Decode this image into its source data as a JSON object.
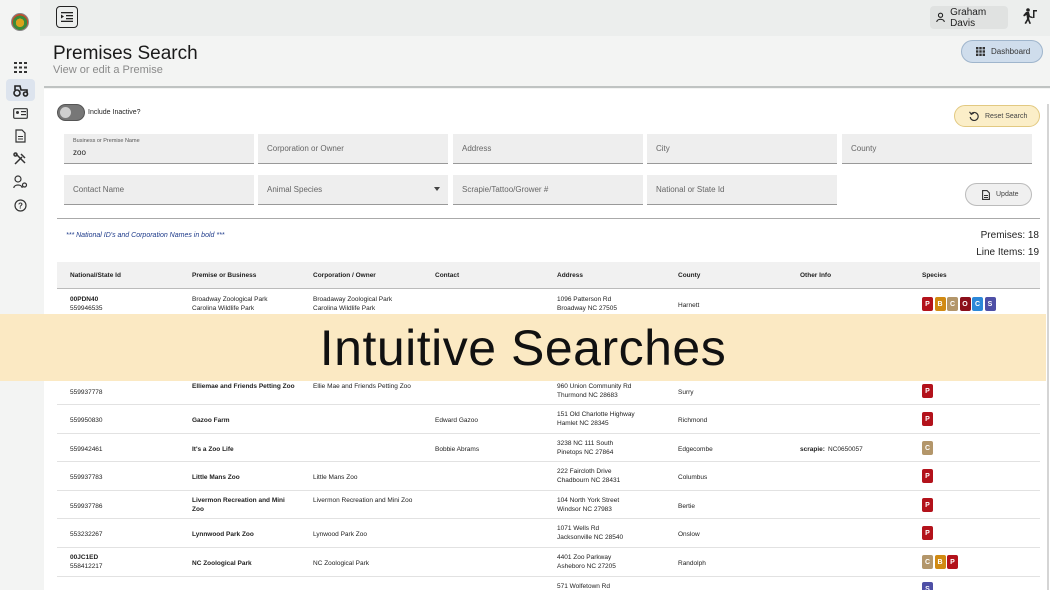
{
  "user": {
    "name": "Graham Davis"
  },
  "header": {
    "title": "Premises Search",
    "subtitle": "View or edit a Premise",
    "dashboard_label": "Dashboard"
  },
  "filters": {
    "include_inactive_label": "Include Inactive?",
    "reset_label": "Reset Search",
    "update_label": "Update",
    "business_label": "Business or Premise Name",
    "business_value": "zoo",
    "corporation_placeholder": "Corporation or Owner",
    "address_placeholder": "Address",
    "city_placeholder": "City",
    "county_placeholder": "County",
    "contact_placeholder": "Contact Name",
    "species_placeholder": "Animal Species",
    "scrapie_placeholder": "Scrapie/Tattoo/Grower #",
    "national_placeholder": "National or State Id"
  },
  "results": {
    "note": "*** National ID's and Corporation Names in bold ***",
    "premises": "Premises: 18",
    "line_items": "Line Items: 19"
  },
  "table": {
    "columns": [
      "National/State Id",
      "Premise or Business",
      "Corporation / Owner",
      "Contact",
      "Address",
      "County",
      "Other Info",
      "Species"
    ],
    "rows": [
      {
        "nid": "00PDN40",
        "sid": "559946535",
        "premise": "Broadway Zoological Park",
        "premise2": "Carolina Wildlife Park",
        "corp": "Broadaway Zoological Park",
        "corp2": "Carolina Wildlife Park",
        "contact": "",
        "addr1": "1096 Patterson Rd",
        "addr2": "Broadway NC 27505",
        "county": "Harnett",
        "other_label": "",
        "other": "",
        "species": [
          "P",
          "B",
          "C",
          "O",
          "C",
          "S"
        ]
      },
      {
        "nid": "",
        "sid": "559937778",
        "premise": "Elliemae and Friends Petting Zoo",
        "premise2": "",
        "corp": "Ellie Mae and Friends Petting Zoo",
        "corp2": "",
        "contact": "",
        "addr1": "960 Union Community Rd",
        "addr2": "Thurmond NC 28683",
        "county": "Surry",
        "other_label": "",
        "other": "",
        "species": [
          "P"
        ]
      },
      {
        "nid": "",
        "sid": "559950830",
        "premise": "Gazoo Farm",
        "premise2": "",
        "corp": "",
        "corp2": "",
        "contact": "Edward Gazoo",
        "addr1": "151 Old Charlotte Highway",
        "addr2": "Hamlet NC 28345",
        "county": "Richmond",
        "other_label": "",
        "other": "",
        "species": [
          "P"
        ]
      },
      {
        "nid": "",
        "sid": "559942461",
        "premise": "It's a Zoo Life",
        "premise2": "",
        "corp": "",
        "corp2": "",
        "contact": "Bobbie Abrams",
        "addr1": "3238 NC 111 South",
        "addr2": "Pinetops NC 27864",
        "county": "Edgecombe",
        "other_label": "scrapie:",
        "other": "NC0650057",
        "species": [
          "C"
        ]
      },
      {
        "nid": "",
        "sid": "559937783",
        "premise": "Little Mans Zoo",
        "premise2": "",
        "corp": "Little Mans Zoo",
        "corp2": "",
        "contact": "",
        "addr1": "222 Faircloth Drive",
        "addr2": "Chadbourn NC 28431",
        "county": "Columbus",
        "other_label": "",
        "other": "",
        "species": [
          "P"
        ]
      },
      {
        "nid": "",
        "sid": "559937786",
        "premise": "Livermon Recreation and Mini Zoo",
        "premise2": "",
        "corp": "Livermon Recreation and Mini Zoo",
        "corp2": "",
        "contact": "",
        "addr1": "104 North York Street",
        "addr2": "Windsor NC 27983",
        "county": "Bertie",
        "other_label": "",
        "other": "",
        "species": [
          "P"
        ]
      },
      {
        "nid": "",
        "sid": "553232267",
        "premise": "Lynnwood Park Zoo",
        "premise2": "",
        "corp": "Lynwood Park Zoo",
        "corp2": "",
        "contact": "",
        "addr1": "1071 Wells Rd",
        "addr2": "Jacksonville NC 28540",
        "county": "Onslow",
        "other_label": "",
        "other": "",
        "species": [
          "P"
        ]
      },
      {
        "nid": "00JC1ED",
        "sid": "558412217",
        "premise": "NC Zoological Park",
        "premise2": "",
        "corp": "NC Zoological Park",
        "corp2": "",
        "contact": "",
        "addr1": "4401 Zoo Parkway",
        "addr2": "Asheboro NC 27205",
        "county": "Randolph",
        "other_label": "",
        "other": "",
        "species": [
          "C",
          "B",
          "P"
        ]
      },
      {
        "nid": "",
        "sid": "",
        "premise": "",
        "premise2": "",
        "corp": "",
        "corp2": "",
        "contact": "",
        "addr1": "571 Wolfetown Rd",
        "addr2": "",
        "county": "",
        "other_label": "",
        "other": "",
        "species": [
          "S"
        ]
      }
    ]
  },
  "species_colors": {
    "P": "#b3121b",
    "B": "#d18a12",
    "C": "#b3966a",
    "O": "#8b0f1a",
    "S": "#4e4fa6",
    "C2": "#2c88d8"
  },
  "banner": {
    "text": "Intuitive Searches"
  }
}
